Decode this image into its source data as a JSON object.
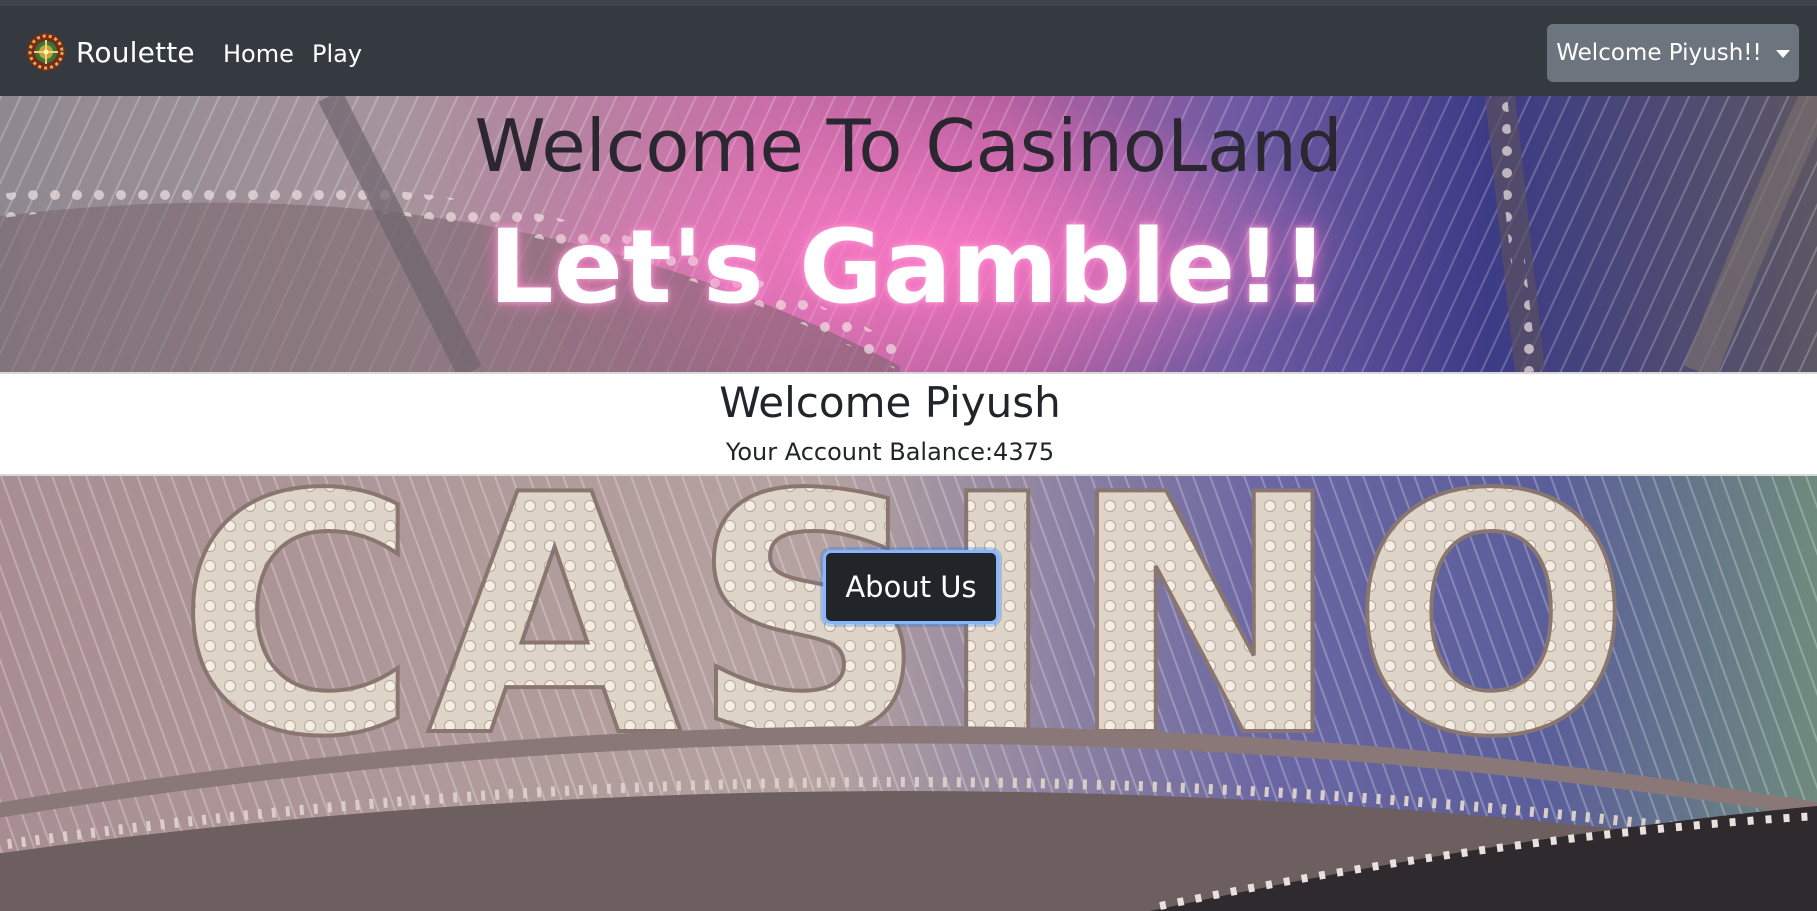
{
  "navbar": {
    "brand": "Roulette",
    "brand_icon": "roulette-wheel-icon",
    "links": [
      "Home",
      "Play"
    ],
    "user_menu_label": "Welcome Piyush!!",
    "colors": {
      "background": "#343a40",
      "user_button": "#6c757d"
    }
  },
  "hero": {
    "title": "Welcome To CasinoLand",
    "subtitle": "Let's Gamble!!"
  },
  "account": {
    "greeting": "Welcome Piyush",
    "balance_label": "Your Account Balance:4375"
  },
  "casino": {
    "about_button": "About Us",
    "sign_text": "CASINO",
    "colors": {
      "button": "#212529",
      "focus_ring": "#86b7fe"
    }
  }
}
